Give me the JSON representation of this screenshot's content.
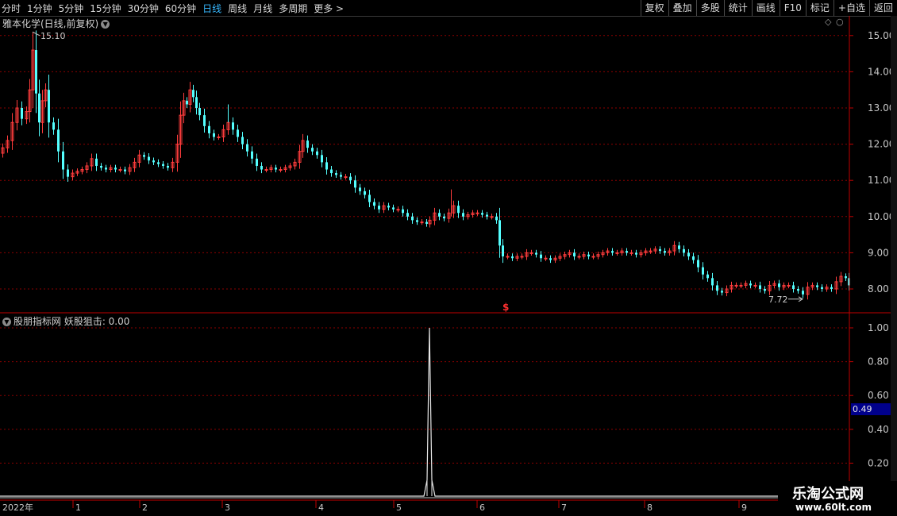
{
  "toolbar": {
    "periods": [
      "分时",
      "1分钟",
      "5分钟",
      "15分钟",
      "30分钟",
      "60分钟",
      "日线",
      "周线",
      "月线",
      "多周期",
      "更多 >"
    ],
    "active_period": "日线",
    "tools": [
      "复权",
      "叠加",
      "多股",
      "统计",
      "画线",
      "F10",
      "标记",
      "+自选",
      "返回"
    ]
  },
  "header": {
    "stock_title": "雅本化学(日线,前复权)",
    "dropdown_icon": "chevron-down-icon"
  },
  "indicator": {
    "title": "股朋指标网 妖股狙击: 0.00",
    "cursor_value": "0.49"
  },
  "price_axis_labels": [
    "15.00",
    "14.00",
    "13.00",
    "12.00",
    "11.00",
    "10.00",
    "9.00",
    "8.00"
  ],
  "ind_axis_labels": [
    "1.00",
    "0.80",
    "0.60",
    "0.40",
    "0.20"
  ],
  "time_axis": [
    "2022年",
    "1",
    "2",
    "3",
    "4",
    "5",
    "6",
    "7",
    "8",
    "9"
  ],
  "annotations": {
    "high": "15.10",
    "low": "7.72",
    "signal": "$"
  },
  "watermark": {
    "line1": "乐淘公式网",
    "line2": "www.60lt.com"
  },
  "colors": {
    "up": "#ff3c3c",
    "down": "#54ffff",
    "grid": "#8b0000",
    "axis": "#c00000"
  },
  "chart_data": {
    "type": "candlestick",
    "indicator_spike_value": 1.0,
    "indicator_spike_date_month": "5"
  }
}
